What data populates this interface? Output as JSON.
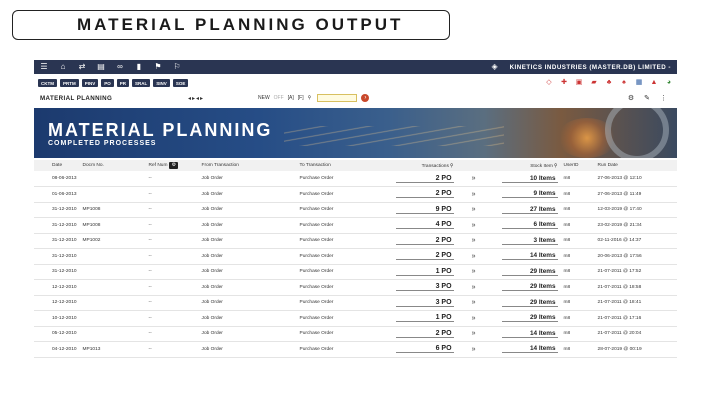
{
  "slide_title": "MATERIAL PLANNING OUTPUT",
  "app": {
    "company": "KINETICS INDUSTRIES (MASTER.DB) LIMITED -",
    "modules": [
      "CKTM",
      "PRTM",
      "PINV",
      "PO",
      "PR",
      "SRAL",
      "SINV",
      "SOE"
    ],
    "page_title": "MATERIAL PLANNING",
    "filter": {
      "new": "NEW",
      "off": "OFF",
      "all": "[A]",
      "first": "[F]"
    },
    "banner": {
      "title": "MATERIAL PLANNING",
      "subtitle": "COMPLETED PROCESSES"
    },
    "columns": {
      "date": "Date",
      "docm": "Docm No.",
      "ref": "Ref Num",
      "from": "From Transaction",
      "to": "To Transaction",
      "transactions": "Transactions",
      "stock": "Stock Item",
      "user": "UserID",
      "run": "Run Date"
    },
    "rows": [
      {
        "date": "08-06-2013",
        "docm": "",
        "ref": "--",
        "from": "Job Order",
        "to": "Purchase Order",
        "tx": "2 PO",
        "stock": "10 Items",
        "user": "m8",
        "run": "27-06-2013 @ 12:10"
      },
      {
        "date": "01-06-2013",
        "docm": "",
        "ref": "--",
        "from": "Job Order",
        "to": "Purchase Order",
        "tx": "2 PO",
        "stock": "9 Items",
        "user": "m8",
        "run": "27-06-2013 @ 11:49"
      },
      {
        "date": "31-12-2010",
        "docm": "MP1008",
        "ref": "--",
        "from": "Job Order",
        "to": "Purchase Order",
        "tx": "9 PO",
        "stock": "27 Items",
        "user": "m8",
        "run": "12-03-2019 @ 17:40"
      },
      {
        "date": "31-12-2010",
        "docm": "MP1008",
        "ref": "--",
        "from": "Job Order",
        "to": "Purchase Order",
        "tx": "4 PO",
        "stock": "6 Items",
        "user": "m8",
        "run": "23-02-2019 @ 21:34"
      },
      {
        "date": "31-12-2010",
        "docm": "MP1002",
        "ref": "--",
        "from": "Job Order",
        "to": "Purchase Order",
        "tx": "2 PO",
        "stock": "3 Items",
        "user": "m8",
        "run": "02-11-2016 @ 14:37"
      },
      {
        "date": "31-12-2010",
        "docm": "",
        "ref": "--",
        "from": "Job Order",
        "to": "Purchase Order",
        "tx": "2 PO",
        "stock": "14 Items",
        "user": "m8",
        "run": "20-06-2013 @ 17:56"
      },
      {
        "date": "31-12-2010",
        "docm": "",
        "ref": "--",
        "from": "Job Order",
        "to": "Purchase Order",
        "tx": "1 PO",
        "stock": "29 Items",
        "user": "m8",
        "run": "21-07-2011 @ 17:52"
      },
      {
        "date": "12-12-2010",
        "docm": "",
        "ref": "--",
        "from": "Job Order",
        "to": "Purchase Order",
        "tx": "3 PO",
        "stock": "29 Items",
        "user": "m8",
        "run": "21-07-2011 @ 18:58"
      },
      {
        "date": "12-12-2010",
        "docm": "",
        "ref": "--",
        "from": "Job Order",
        "to": "Purchase Order",
        "tx": "3 PO",
        "stock": "29 Items",
        "user": "m8",
        "run": "21-07-2011 @ 18:41"
      },
      {
        "date": "10-12-2010",
        "docm": "",
        "ref": "--",
        "from": "Job Order",
        "to": "Purchase Order",
        "tx": "1 PO",
        "stock": "29 Items",
        "user": "m8",
        "run": "21-07-2011 @ 17:16"
      },
      {
        "date": "05-12-2010",
        "docm": "",
        "ref": "--",
        "from": "Job Order",
        "to": "Purchase Order",
        "tx": "2 PO",
        "stock": "14 Items",
        "user": "m8",
        "run": "21-07-2011 @ 20:04"
      },
      {
        "date": "04-12-2010",
        "docm": "MP1013",
        "ref": "--",
        "from": "Job Order",
        "to": "Purchase Order",
        "tx": "6 PO",
        "stock": "14 Items",
        "user": "m8",
        "run": "28-07-2019 @ 00:19"
      }
    ]
  },
  "colors": {
    "navbar": "#2a3552",
    "accent": "#c9482b",
    "banner": "#264d86"
  },
  "icons": [
    "menu-icon",
    "home-icon",
    "swap-icon",
    "map-icon",
    "link-icon",
    "bookmark-icon",
    "flag-icon",
    "flag-outline-icon",
    "tag-icon",
    "search-icon",
    "gear-icon",
    "edit-icon",
    "settings-toggle-icon",
    "double-chevron-icon"
  ]
}
